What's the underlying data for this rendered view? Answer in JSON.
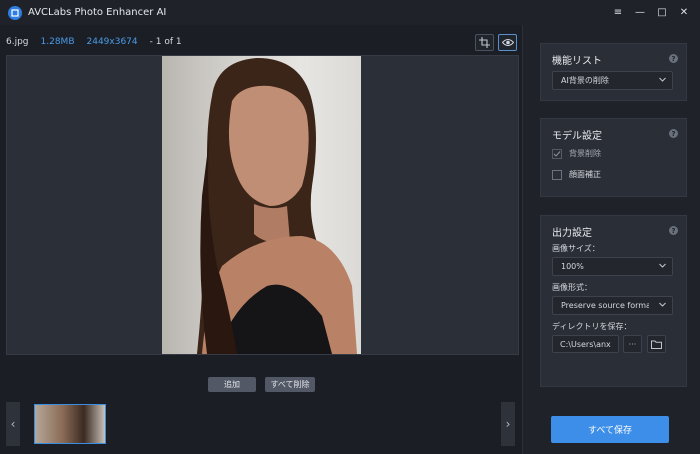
{
  "window": {
    "title": "AVCLabs Photo Enhancer AI",
    "controls": {
      "menu": "≡",
      "minimize": "—",
      "maximize": "□",
      "close": "✕"
    }
  },
  "file_info": {
    "name": "6.jpg",
    "size": "1.28MB",
    "dimensions": "2449x3674",
    "page": "- 1 of 1"
  },
  "actions": {
    "add_label": "追加",
    "delete_all_label": "すべて削除"
  },
  "function_list": {
    "title": "機能リスト",
    "selected": "AI背景の削除"
  },
  "model_settings": {
    "title": "モデル設定",
    "options": [
      {
        "label": "背景削除",
        "checked": true
      },
      {
        "label": "顔面補正",
        "checked": false
      }
    ]
  },
  "output_settings": {
    "title": "出力設定",
    "image_size_label": "画像サイズ：",
    "image_size_value": "100%",
    "image_format_label": "画像形式：",
    "image_format_value": "Preserve source format",
    "directory_label": "ディレクトリを保存：",
    "directory_value": "C:\\Users\\anx",
    "browse_label": "···"
  },
  "save_all_label": "すべて保存",
  "colors": {
    "accent": "#3d8ee8",
    "info_blue": "#4a9be8",
    "background": "#1b1e24",
    "panel": "#2a2e36"
  }
}
